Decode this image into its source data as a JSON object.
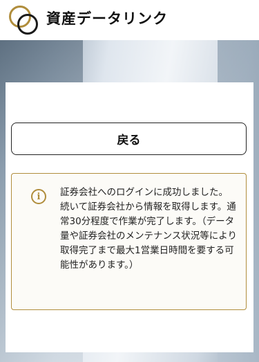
{
  "header": {
    "brand_name": "資産データリンク"
  },
  "card": {
    "back_button_label": "戻る",
    "notice": {
      "icon": "info-icon",
      "text": "証券会社へのログインに成功しました。\n続いて証券会社から情報を取得します。通常30分程度で作業が完了します。（データ量や証券会社のメンテナンス状況等により取得完了まで最大1営業日時間を要する可能性があります。）"
    }
  },
  "colors": {
    "accent_gold": "#b08d3c",
    "text_dark": "#111111"
  }
}
